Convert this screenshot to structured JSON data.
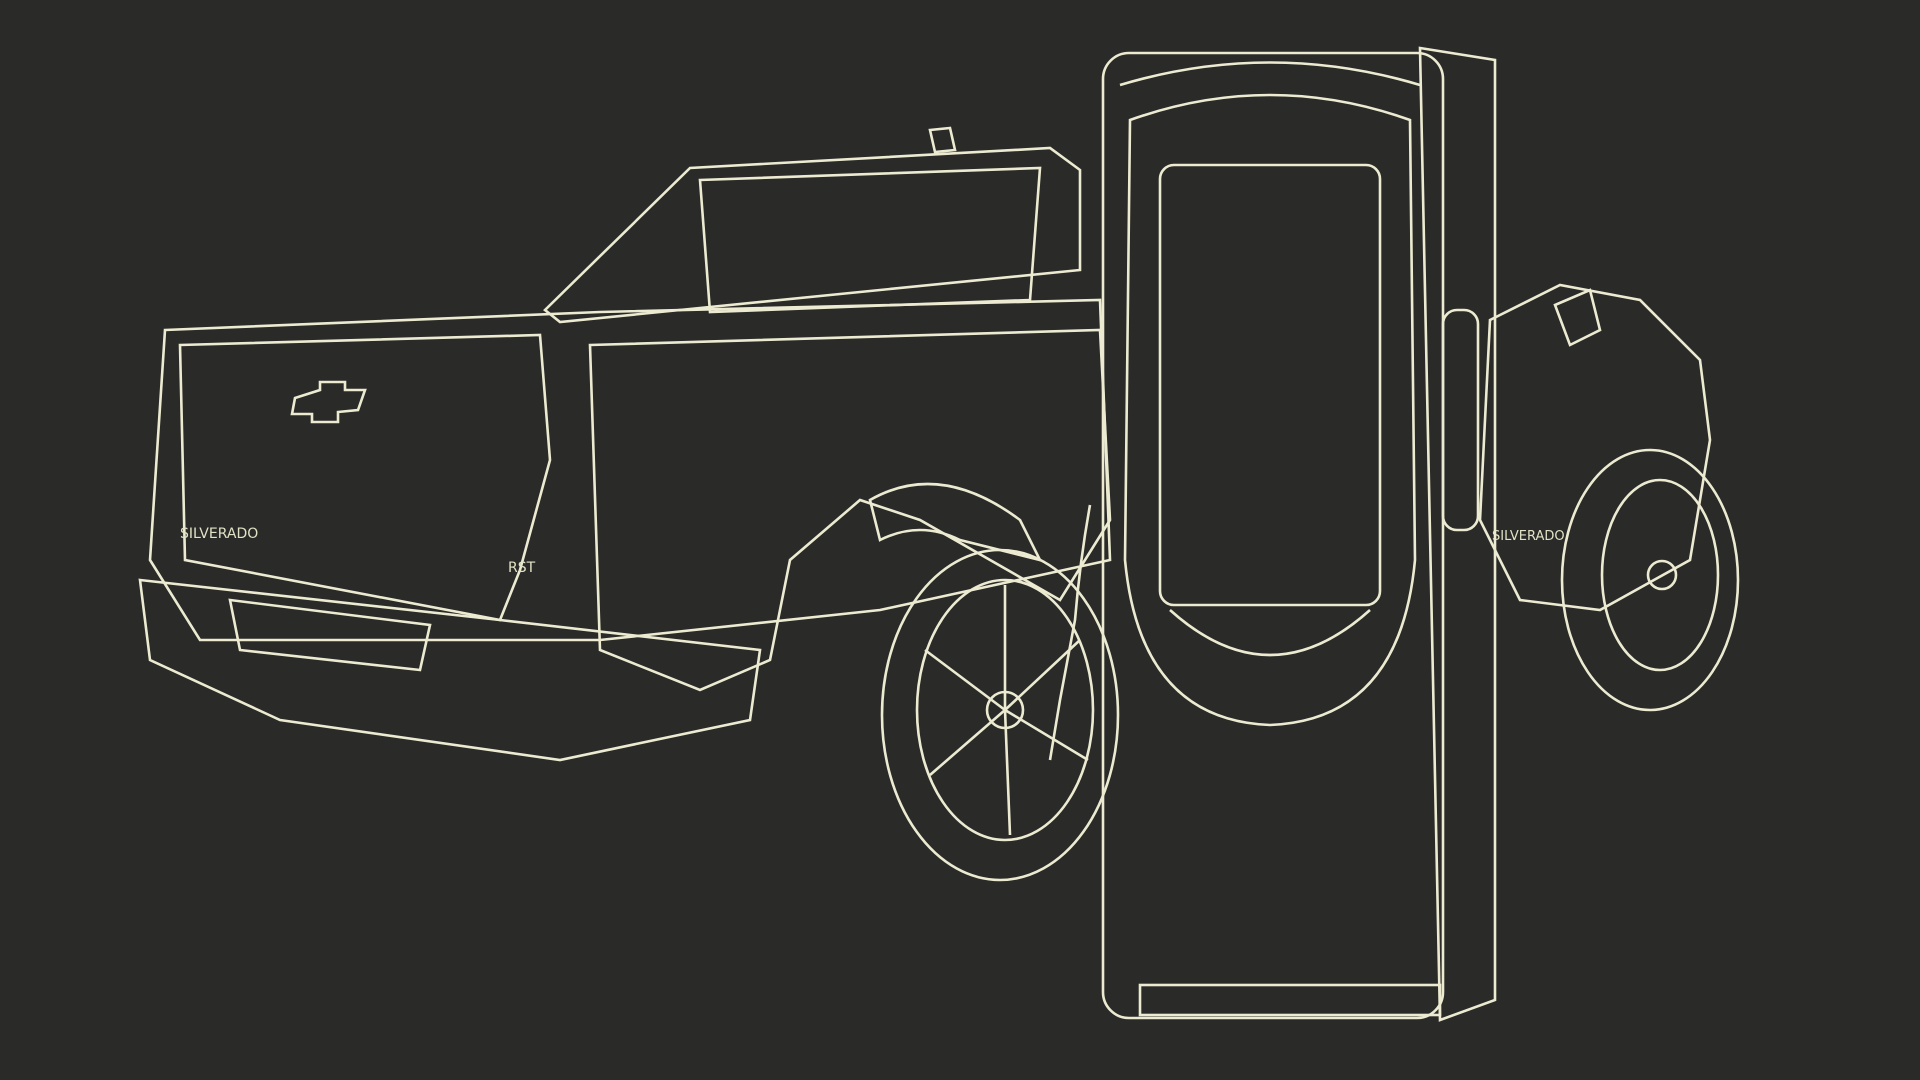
{
  "scene": {
    "background": "#2a2a28",
    "surface_color": "#7e7f73",
    "wire_color": "#e2e2c6",
    "objects": [
      {
        "name": "pickup-truck",
        "badges": [
          "SILVERADO",
          "RST",
          "SILVERADO"
        ]
      },
      {
        "name": "ev-charging-station"
      }
    ]
  }
}
